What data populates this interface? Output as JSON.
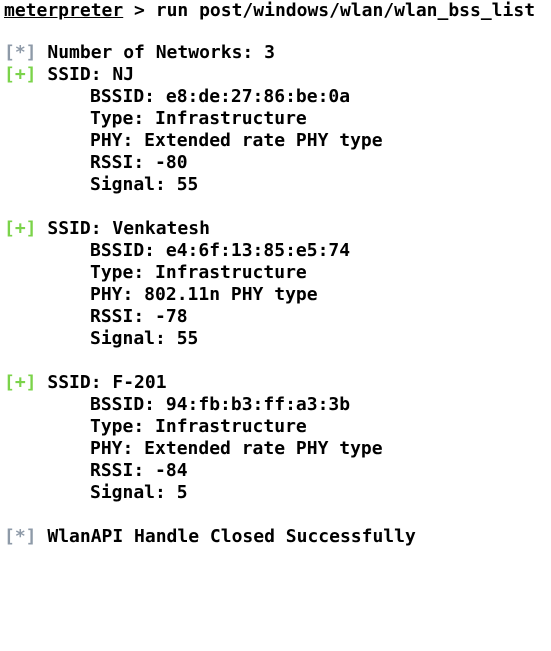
{
  "terminal": {
    "prompt": {
      "name": "meterpreter",
      "sep": " > ",
      "command": "run post/windows/wlan/wlan_bss_list"
    },
    "summary": {
      "marker": "[*]",
      "text": " Number of Networks: 3"
    },
    "networks": [
      {
        "marker": "[+]",
        "ssid": " SSID: NJ",
        "bssid": "BSSID: e8:de:27:86:be:0a",
        "type": "Type: Infrastructure",
        "phy": "PHY: Extended rate PHY type",
        "rssi": "RSSI: -80",
        "signal": "Signal: 55"
      },
      {
        "marker": "[+]",
        "ssid": " SSID: Venkatesh",
        "bssid": "BSSID: e4:6f:13:85:e5:74",
        "type": "Type: Infrastructure",
        "phy": "PHY: 802.11n PHY type",
        "rssi": "RSSI: -78",
        "signal": "Signal: 55"
      },
      {
        "marker": "[+]",
        "ssid": " SSID: F-201",
        "bssid": "BSSID: 94:fb:b3:ff:a3:3b",
        "type": "Type: Infrastructure",
        "phy": "PHY: Extended rate PHY type",
        "rssi": "RSSI: -84",
        "signal": "Signal: 5"
      }
    ],
    "footer": {
      "marker": "[*]",
      "text": " WlanAPI Handle Closed Successfully"
    },
    "colors": {
      "info_marker": "#8e9aa8",
      "good_marker": "#7bd34a",
      "text": "#000000",
      "background": "#ffffff"
    }
  }
}
